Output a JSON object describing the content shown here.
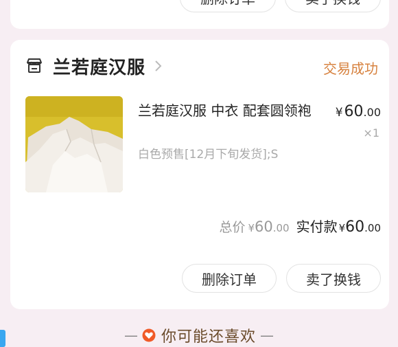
{
  "prev_order": {
    "delete_label": "删除订单",
    "sell_label": "卖了换钱"
  },
  "order": {
    "shop_name": "兰若庭汉服",
    "status": "交易成功",
    "item": {
      "title": "兰若庭汉服  中衣  配套圆领袍",
      "spec": "白色预售[12月下旬发货];S",
      "price_symbol": "¥",
      "price_int": "60",
      "price_cents": ".00",
      "qty": "×1"
    },
    "totals": {
      "total_label": "总价",
      "total_symbol": "¥",
      "total_int": "60",
      "total_cents": ".00",
      "paid_label": "实付款",
      "paid_symbol": "¥",
      "paid_int": "60",
      "paid_cents": ".00"
    },
    "actions": {
      "delete_label": "删除订单",
      "sell_label": "卖了换钱"
    }
  },
  "recommend": {
    "left_dash": "—",
    "label": "你可能还喜欢",
    "right_dash": "—"
  },
  "colors": {
    "status": "#d7823f",
    "background": "#f7eef3",
    "heart": "#f05a28"
  },
  "icons": {
    "shop": "store-icon",
    "chevron": "chevron-right-icon",
    "heart": "heart-icon"
  }
}
